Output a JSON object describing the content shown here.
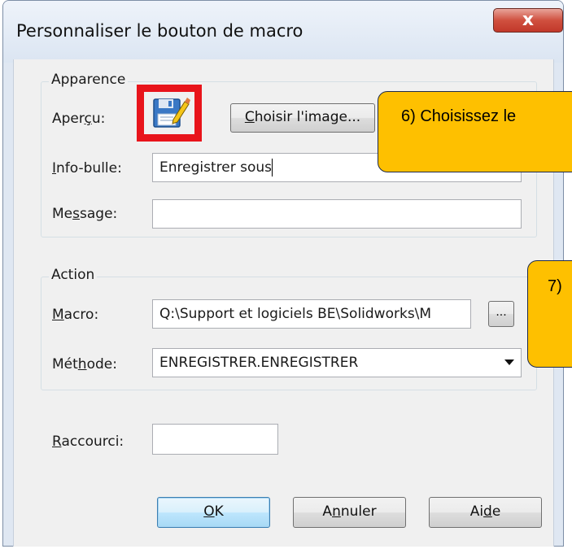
{
  "window": {
    "title": "Personnaliser le bouton de macro",
    "close_glyph": "x"
  },
  "appearance_group": {
    "label": "Apparence",
    "preview_label_pre": "Aper",
    "preview_label_u": "ç",
    "preview_label_post": "u:",
    "preview_icon": "floppy-disk-save-as-icon",
    "choose_image_label_u": "C",
    "choose_image_label_post": "hoisir l'image...",
    "tooltip_label_u": "I",
    "tooltip_label_post": "nfo-bulle:",
    "tooltip_value": "Enregistrer sous",
    "message_label_pre": "Me",
    "message_label_u": "s",
    "message_label_post": "sage:",
    "message_value": ""
  },
  "action_group": {
    "label": "Action",
    "macro_label_u": "M",
    "macro_label_post": "acro:",
    "macro_value": "Q:\\Support et logiciels BE\\Solidworks\\M",
    "browse_label": "...",
    "method_label_pre": "Mét",
    "method_label_u": "h",
    "method_label_post": "ode:",
    "method_value": "ENREGISTRER.ENREGISTRER"
  },
  "shortcut": {
    "label_u": "R",
    "label_post": "accourci:",
    "value": ""
  },
  "buttons": {
    "ok_u": "O",
    "ok_post": "K",
    "cancel_pre": "A",
    "cancel_u": "n",
    "cancel_post": "nuler",
    "help_pre": "Ai",
    "help_u": "d",
    "help_post": "e"
  },
  "annotations": {
    "callout_6": "6) Choisissez le",
    "callout_7": "7)"
  },
  "colors": {
    "callout_fill": "#fec000",
    "highlight_box": "#e8141b"
  }
}
